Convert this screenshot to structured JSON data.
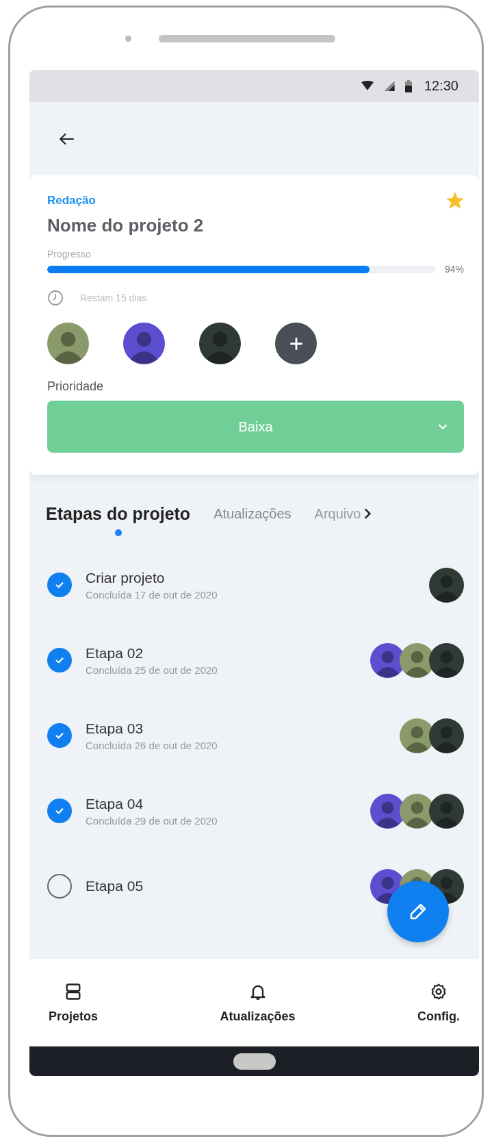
{
  "status_bar": {
    "time": "12:30"
  },
  "project": {
    "category": "Redação",
    "name": "Nome do projeto 2",
    "favorite": true,
    "progress_label": "Progresso",
    "progress": {
      "level": 0.83,
      "reading": "94%"
    },
    "remaining": "Restam 15 dias",
    "members": [
      {
        "kind": "avatar",
        "color": "#8a9a6a"
      },
      {
        "kind": "avatar",
        "color": "#5b4fd0"
      },
      {
        "kind": "avatar",
        "color": "#2f3a35"
      },
      {
        "kind": "add",
        "color": "#4a4e56"
      }
    ],
    "priority": {
      "label": "Prioridade",
      "value": "Baixa"
    }
  },
  "tabs": [
    {
      "label": "Etapas do projeto",
      "selected": true
    },
    {
      "label": "Atualizações",
      "selected": false
    },
    {
      "label": "Arquivo",
      "selected": false
    }
  ],
  "steps": [
    {
      "title": "Criar projeto",
      "subtitle": "Concluída 17 de out de 2020",
      "checked": true,
      "avatars": [
        {
          "color": "#2f3a35"
        }
      ]
    },
    {
      "title": "Etapa 02",
      "subtitle": "Concluída 25 de out de 2020",
      "checked": true,
      "avatars": [
        {
          "color": "#5b4fd0"
        },
        {
          "color": "#8a9a6a"
        },
        {
          "color": "#2f3a35"
        }
      ]
    },
    {
      "title": "Etapa 03",
      "subtitle": "Concluída 26 de out de 2020",
      "checked": true,
      "avatars": [
        {
          "color": "#8a9a6a"
        },
        {
          "color": "#2f3a35"
        }
      ]
    },
    {
      "title": "Etapa 04",
      "subtitle": "Concluída 29 de out de 2020",
      "checked": true,
      "avatars": [
        {
          "color": "#5b4fd0"
        },
        {
          "color": "#8a9a6a"
        },
        {
          "color": "#2f3a35"
        }
      ]
    },
    {
      "title": "Etapa 05",
      "checked": false,
      "avatars": [
        {
          "color": "#5b4fd0"
        },
        {
          "color": "#8a9a6a"
        },
        {
          "color": "#2f3a35"
        }
      ]
    }
  ],
  "nav": [
    {
      "label": "Projetos",
      "kind": "projects"
    },
    {
      "label": "Atualizações",
      "kind": "bell"
    },
    {
      "label": "Config.",
      "kind": "gear"
    }
  ]
}
